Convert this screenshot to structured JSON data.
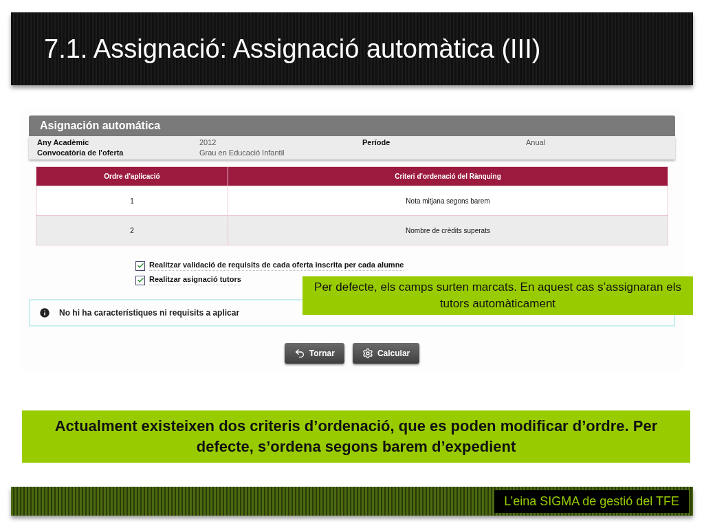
{
  "slide_title": "7.1. Assignació: Assignació automàtica (III)",
  "app": {
    "panel_title": "Asignación automática",
    "fields": [
      {
        "label": "Any Acadèmic",
        "value": "2012"
      },
      {
        "label": "Període",
        "value": "Anual"
      },
      {
        "label": "Convocatòria de l'oferta",
        "value": "Grau en Educació Infantil"
      }
    ],
    "table": {
      "columns": [
        "Ordre d'aplicació",
        "Criteri d'ordenació del Rànquing"
      ],
      "rows": [
        [
          "1",
          "Nota mitjana segons barem"
        ],
        [
          "2",
          "Nombre de crèdits superats"
        ]
      ]
    },
    "options": [
      {
        "label": "Realitzar validació de requisits de cada oferta inscrita per cada alumne",
        "checked": true
      },
      {
        "label": "Realitzar asignació tutors",
        "checked": true
      }
    ],
    "info_message": "No hi ha característiques ni requisits a aplicar",
    "buttons": [
      {
        "label": "Tornar",
        "kind": "back"
      },
      {
        "label": "Calcular",
        "kind": "settings"
      }
    ]
  },
  "callout": "Per defecte, els camps surten marcats. En aquest cas s’assignaran els tutors automàticament",
  "note": "Actualment existeixen dos criteris d’ordenació, que es poden modificar d’ordre. Per defecte, s’ordena segons barem d’expedient",
  "footer": "L’eina SIGMA de gestió del TFE"
}
